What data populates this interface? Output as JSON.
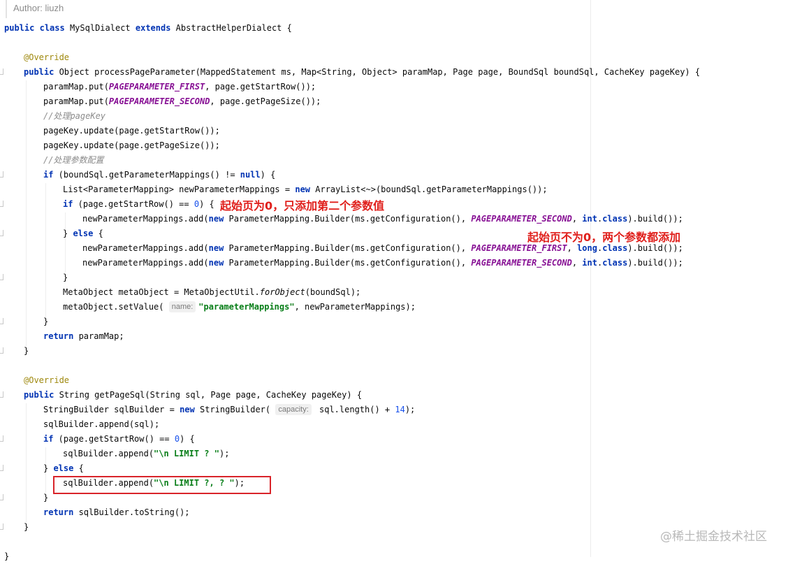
{
  "author": "Author: liuzh",
  "tokens": {
    "public": "public",
    "class": "class",
    "extends": "extends",
    "if": "if",
    "else": "else",
    "new": "new",
    "return": "return",
    "null": "null",
    "int": "int",
    "long": "long",
    "class_kw": "class",
    "override": "@Override"
  },
  "code": {
    "l1_name": " MySqlDialect ",
    "l1_super": " AbstractHelperDialect {",
    "l2_sig": " Object processPageParameter(MappedStatement ms, Map<String, Object> paramMap, Page page, BoundSql boundSql, CacheKey pageKey) {",
    "put": "paramMap.put(",
    "first": "PAGEPARAMETER_FIRST",
    "second": "PAGEPARAMETER_SECOND",
    "start_row_end": ", page.getStartRow());",
    "page_size_end": ", page.getPageSize());",
    "comment_pagekey": "//处理pageKey",
    "pagekey_start": "pageKey.update(page.getStartRow());",
    "pagekey_size": "pageKey.update(page.getPageSize());",
    "comment_params": "//处理参数配置",
    "if_mappings": " (boundSql.getParameterMappings() != ",
    "if_mappings_end": ") {",
    "list_decl_a": "List<ParameterMapping> newParameterMappings = ",
    "list_decl_b": " ArrayList<~>(boundSql.getParameterMappings());",
    "if_start": " (page.getStartRow() == ",
    "zero": "0",
    "brace_open": ") {",
    "add_a": "newParameterMappings.add(",
    "add_b": " ParameterMapping.Builder(ms.getConfiguration(), ",
    "sep": ", ",
    "class_end": ").build());",
    "close_else_a": "} ",
    "close_else_b": " {",
    "close_brace": "}",
    "meta_a": "MetaObject metaObject = MetaObjectUtil.",
    "meta_method": "forObject",
    "meta_b": "(boundSql);",
    "set_value_a": "metaObject.setValue( ",
    "hint_name": "name:",
    "set_value_str": "\"parameterMappings\"",
    "set_value_b": ", newParameterMappings);",
    "return_map": " paramMap;",
    "getpagesql_sig": " String getPageSql(String sql, Page page, CacheKey pageKey) {",
    "sb_a": "StringBuilder sqlBuilder = ",
    "sb_b": " StringBuilder( ",
    "hint_capacity": "capacity:",
    "sb_c": " sql.length() + ",
    "fourteen": "14",
    "sb_end": ");",
    "append_sql": "sqlBuilder.append(sql);",
    "append_a": "sqlBuilder.append(",
    "limit_one": "\"\\n LIMIT ? \"",
    "limit_two": "\"\\n LIMIT ?, ? \"",
    "append_end": ");",
    "return_sb": " sqlBuilder.toString();",
    "final_brace": "}"
  },
  "annotations": {
    "start_zero": "起始页为0，只添加第二个参数值",
    "start_nonzero": "起始页不为0，两个参数都添加"
  },
  "watermark": "@稀土掘金技术社区",
  "colors": {
    "keyword": "#0033b3",
    "annotation": "#9e880d",
    "comment": "#8c8c8c",
    "constant": "#871094",
    "string": "#067d17",
    "number": "#1750eb",
    "note": "#e0201c",
    "highlight_box": "#d9242a"
  }
}
